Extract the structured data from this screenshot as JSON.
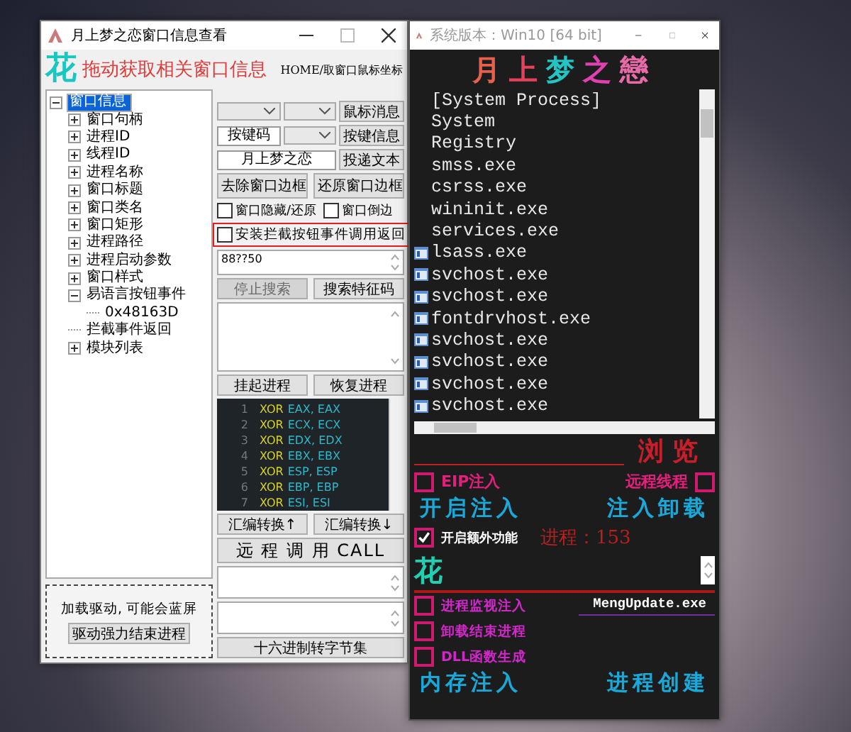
{
  "main_window": {
    "title": "月上梦之恋窗口信息查看",
    "logo": "花",
    "caption": "拖动获取相关窗口信息",
    "hint": "HOME/取窗口鼠标坐标",
    "tree": [
      {
        "label": "窗口信息",
        "selected": true,
        "kind": "branch",
        "expanded": true,
        "children": [
          {
            "label": "窗口句柄",
            "selected": false,
            "kind": "branch",
            "expanded": false
          },
          {
            "label": "进程ID",
            "selected": false,
            "kind": "branch",
            "expanded": false
          },
          {
            "label": "线程ID",
            "selected": false,
            "kind": "branch",
            "expanded": false
          },
          {
            "label": "进程名称",
            "selected": false,
            "kind": "branch",
            "expanded": false
          },
          {
            "label": "窗口标题",
            "selected": false,
            "kind": "branch",
            "expanded": false
          },
          {
            "label": "窗口类名",
            "selected": false,
            "kind": "branch",
            "expanded": false
          },
          {
            "label": "窗口矩形",
            "selected": false,
            "kind": "branch",
            "expanded": false
          },
          {
            "label": "进程路径",
            "selected": false,
            "kind": "branch",
            "expanded": false
          },
          {
            "label": "进程启动参数",
            "selected": false,
            "kind": "branch",
            "expanded": false
          },
          {
            "label": "窗口样式",
            "selected": false,
            "kind": "branch",
            "expanded": false
          },
          {
            "label": "易语言按钮事件",
            "selected": false,
            "kind": "branch",
            "expanded": true,
            "children": [
              {
                "label": "0x48163D",
                "selected": false,
                "kind": "leaf"
              }
            ]
          },
          {
            "label": "拦截事件返回",
            "selected": false,
            "kind": "leaf"
          },
          {
            "label": "模块列表",
            "selected": false,
            "kind": "branch",
            "expanded": false
          }
        ]
      }
    ],
    "mouse_button": "鼠标消息",
    "key_row": {
      "value": "按键码",
      "button": "按键信息"
    },
    "text_row": {
      "value": "月上梦之恋",
      "button": "投递文本"
    },
    "border_buttons": [
      "去除窗口边框",
      "还原窗口边框"
    ],
    "options": [
      {
        "label": "窗口隐藏/还原",
        "checked": false
      },
      {
        "label": "窗口倒边",
        "checked": false
      }
    ],
    "hook_option": {
      "label": "安装拦截按钮事件调用返回",
      "checked": false,
      "highlighted": true
    },
    "pattern": "88??50",
    "search_buttons": [
      {
        "label": "停止搜索",
        "disabled": true
      },
      {
        "label": "搜索特征码",
        "disabled": false
      }
    ],
    "process_buttons": [
      "挂起进程",
      "恢复进程"
    ],
    "code_lines": [
      {
        "number": "1",
        "op": "XOR",
        "args": "EAX, EAX"
      },
      {
        "number": "2",
        "op": "XOR",
        "args": "ECX, ECX"
      },
      {
        "number": "3",
        "op": "XOR",
        "args": "EDX, EDX"
      },
      {
        "number": "4",
        "op": "XOR",
        "args": "EBX, EBX"
      },
      {
        "number": "5",
        "op": "XOR",
        "args": "ESP, ESP"
      },
      {
        "number": "6",
        "op": "XOR",
        "args": "EBP, EBP"
      },
      {
        "number": "7",
        "op": "XOR",
        "args": "ESI, ESI"
      }
    ],
    "asm_buttons": [
      "汇编转换↑",
      "汇编转换↓"
    ],
    "call_button": "远 程 调 用 CALL",
    "convert_button": "十六进制转字节集",
    "driver": {
      "note": "加载驱动, 可能会蓝屏",
      "button": "驱动强力结束进程"
    }
  },
  "injector_window": {
    "title": "系统版本：Win10 [64 bit]",
    "logo": [
      {
        "char": "月",
        "color": "#e8604c"
      },
      {
        "char": "上",
        "color": "#e8405a"
      },
      {
        "char": "梦",
        "color": "#22c4c4"
      },
      {
        "char": "之",
        "color": "#e040b0"
      },
      {
        "char": "戀",
        "color": "#e86aa8"
      }
    ],
    "processes": [
      {
        "name": "[System Process]",
        "has_icon": false
      },
      {
        "name": "System",
        "has_icon": false
      },
      {
        "name": "Registry",
        "has_icon": false
      },
      {
        "name": "smss.exe",
        "has_icon": false
      },
      {
        "name": "csrss.exe",
        "has_icon": false
      },
      {
        "name": "wininit.exe",
        "has_icon": false
      },
      {
        "name": "services.exe",
        "has_icon": false
      },
      {
        "name": "lsass.exe",
        "has_icon": true
      },
      {
        "name": "svchost.exe",
        "has_icon": true
      },
      {
        "name": "svchost.exe",
        "has_icon": true
      },
      {
        "name": "fontdrvhost.exe",
        "has_icon": true
      },
      {
        "name": "svchost.exe",
        "has_icon": true
      },
      {
        "name": "svchost.exe",
        "has_icon": true
      },
      {
        "name": "svchost.exe",
        "has_icon": true
      },
      {
        "name": "svchost.exe",
        "has_icon": true
      }
    ],
    "browse_button": "浏览",
    "top_options": [
      {
        "label": "EIP注入",
        "checked": false
      },
      {
        "label": "远程线程",
        "checked": false
      }
    ],
    "inject_buttons": [
      "开启注入",
      "注入卸载"
    ],
    "extra_option": {
      "label": "开启额外功能",
      "checked": true
    },
    "process_count": "进程：153",
    "logo_small": "花",
    "monitor_options": [
      {
        "label": "进程监视注入",
        "checked": false
      },
      {
        "label": "卸载结束进程",
        "checked": false
      },
      {
        "label": "DLL函数生成",
        "checked": false
      }
    ],
    "target": "MengUpdate.exe",
    "bottom_buttons": [
      "内存注入",
      "进程创建"
    ]
  }
}
